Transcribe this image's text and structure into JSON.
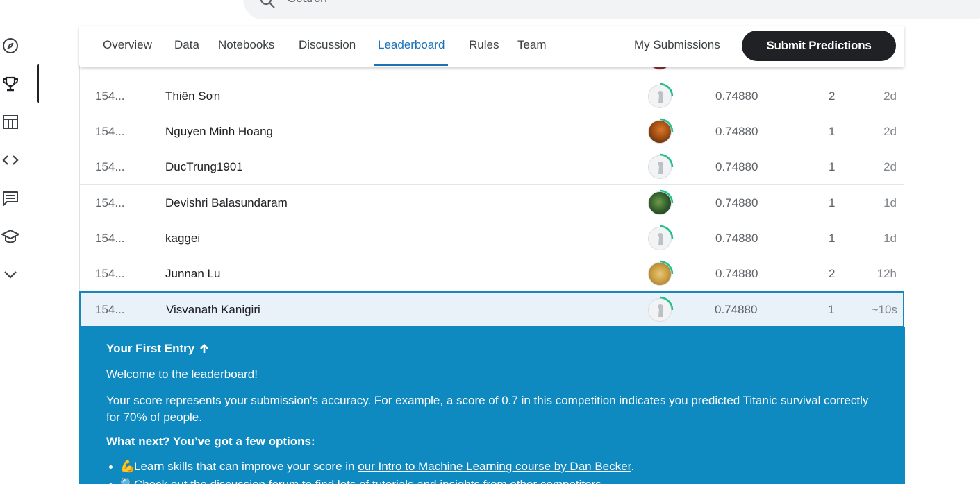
{
  "search": {
    "placeholder": "Search"
  },
  "nav": {
    "items": [
      {
        "name": "compass-icon"
      },
      {
        "name": "trophy-icon",
        "active": true
      },
      {
        "name": "table-icon"
      },
      {
        "name": "code-icon"
      },
      {
        "name": "comments-icon"
      },
      {
        "name": "graduation-cap-icon"
      },
      {
        "name": "chevron-down-icon"
      }
    ]
  },
  "tabs": [
    "Overview",
    "Data",
    "Notebooks",
    "Discussion",
    "Leaderboard",
    "Rules",
    "Team"
  ],
  "active_tab": "Leaderboard",
  "header": {
    "my_submissions": "My Submissions",
    "submit_label": "Submit Predictions"
  },
  "leaderboard": {
    "rows": [
      {
        "rank": "154...",
        "name": "Thiên Sơn",
        "score": "0.74880",
        "entries": "2",
        "last": "2d",
        "avatar": "default"
      },
      {
        "rank": "154...",
        "name": "Nguyen Minh Hoang",
        "score": "0.74880",
        "entries": "1",
        "last": "2d",
        "avatar": "photo-orange"
      },
      {
        "rank": "154...",
        "name": "DucTrung1901",
        "score": "0.74880",
        "entries": "1",
        "last": "2d",
        "avatar": "default"
      },
      {
        "rank": "154...",
        "name": "Devishri Balasundaram",
        "score": "0.74880",
        "entries": "1",
        "last": "1d",
        "avatar": "photo-green"
      },
      {
        "rank": "154...",
        "name": "kaggei",
        "score": "0.74880",
        "entries": "1",
        "last": "1d",
        "avatar": "default"
      },
      {
        "rank": "154...",
        "name": "Junnan Lu",
        "score": "0.74880",
        "entries": "2",
        "last": "12h",
        "avatar": "photo-gold"
      },
      {
        "rank": "154...",
        "name": "Visvanath Kanigiri",
        "score": "0.74880",
        "entries": "1",
        "last": "~10s",
        "avatar": "default",
        "highlight": true
      }
    ]
  },
  "panel": {
    "title": "Your First Entry",
    "welcome": "Welcome to the leaderboard!",
    "description": "Your score represents your submission's accuracy. For example, a score of 0.7 in this competition indicates you predicted Titanic survival correctly for 70% of people.",
    "next_heading": "What next? You’ve got a few options:",
    "options": [
      {
        "emoji": "💪",
        "text": "Learn skills that can improve your score in ",
        "link": "our Intro to Machine Learning course by Dan Becker",
        "after": "."
      },
      {
        "emoji": "🔍",
        "text": "Check out the discussion forum to find lots of tutorials and insights from other competitors",
        "link": "",
        "after": "."
      }
    ]
  },
  "colors": {
    "accent": "#1a73b8",
    "panel_bg": "#0f8ac0",
    "button_bg": "#202124",
    "highlight_row": "#e8f2f8",
    "progress_ring": "#20be8a"
  }
}
